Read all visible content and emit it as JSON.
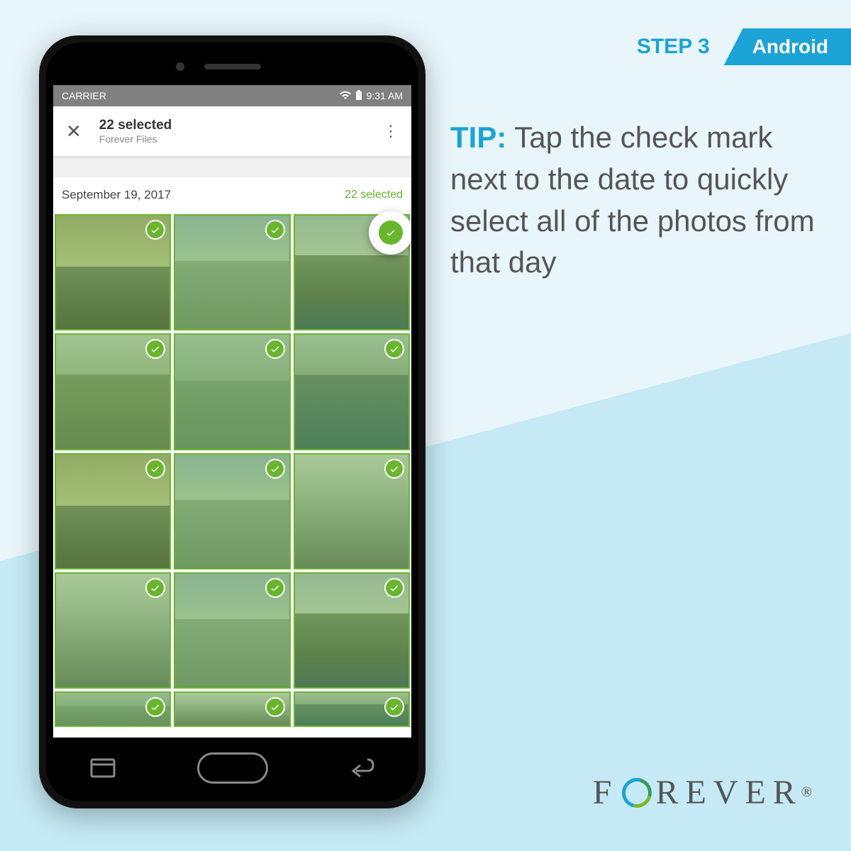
{
  "header": {
    "step_label": "STEP 3",
    "platform": "Android"
  },
  "tip": {
    "label": "TIP:",
    "body": "Tap the check mark next to the date to quickly select all of the photos from that day"
  },
  "status_bar": {
    "carrier": "CARRIER",
    "time": "9:31 AM"
  },
  "app_bar": {
    "title": "22 selected",
    "subtitle": "Forever Files"
  },
  "date_section": {
    "date": "September 19, 2017",
    "selection": "22 selected"
  },
  "photos": [
    {
      "selected": true,
      "scenery": "skyline"
    },
    {
      "selected": true,
      "scenery": "falls"
    },
    {
      "selected": true,
      "scenery": "mountain"
    },
    {
      "selected": true,
      "scenery": "hills"
    },
    {
      "selected": true,
      "scenery": "water"
    },
    {
      "selected": true,
      "scenery": "bridge"
    },
    {
      "selected": true,
      "scenery": "skyline"
    },
    {
      "selected": true,
      "scenery": "falls"
    },
    {
      "selected": true,
      "scenery": "mist"
    },
    {
      "selected": true,
      "scenery": "mist"
    },
    {
      "selected": true,
      "scenery": "falls"
    },
    {
      "selected": true,
      "scenery": "mountain"
    },
    {
      "selected": true,
      "scenery": "water"
    },
    {
      "selected": true,
      "scenery": "mist"
    },
    {
      "selected": true,
      "scenery": "bridge"
    }
  ],
  "brand": {
    "name": "FOREVER",
    "registered": "®"
  }
}
